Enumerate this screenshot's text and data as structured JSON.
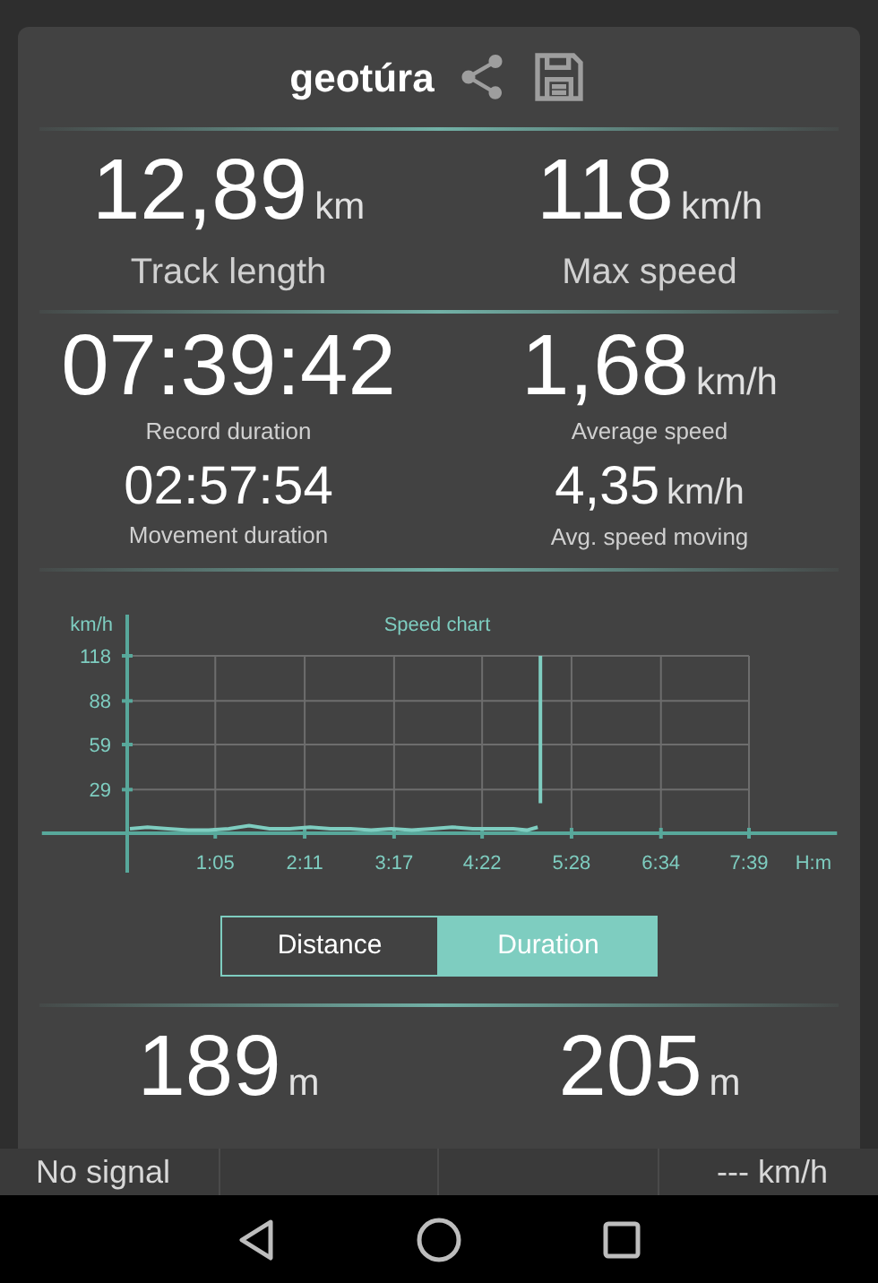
{
  "header": {
    "title": "geotúra"
  },
  "stat_sections": [
    {
      "items": [
        {
          "kind": "primary",
          "value": "12,89",
          "unit": "km",
          "label": "Track length"
        },
        {
          "kind": "primary",
          "value": "118",
          "unit": "km/h",
          "label": "Max speed"
        }
      ]
    },
    {
      "items": [
        {
          "kind": "secondary",
          "value": "07:39:42",
          "label": "Record duration"
        },
        {
          "kind": "secondary",
          "value": "1,68",
          "unit": "km/h",
          "label": "Average speed"
        },
        {
          "kind": "tertiary",
          "value": "02:57:54",
          "label": "Movement duration"
        },
        {
          "kind": "tertiary",
          "value": "4,35",
          "unit": "km/h",
          "label": "Avg. speed moving"
        }
      ]
    }
  ],
  "chart": {
    "chart_data": {
      "type": "line",
      "title": "Speed chart",
      "ylabel": "km/h",
      "xlabel": "H:m",
      "x": [
        2,
        15,
        30,
        45,
        60,
        75,
        90,
        105,
        120,
        135,
        150,
        165,
        180,
        195,
        210,
        225,
        240,
        255,
        270,
        285,
        295,
        303,
        null,
        305,
        305
      ],
      "series": [
        {
          "color": "#7ecdc0",
          "values": [
            3,
            4,
            3,
            2,
            2,
            3,
            5,
            3,
            3,
            4,
            3,
            3,
            2,
            3,
            2,
            3,
            4,
            3,
            3,
            3,
            2,
            4,
            null,
            118,
            20
          ]
        }
      ],
      "grid": true,
      "xlim": [
        -63,
        524
      ],
      "ylim": [
        0,
        118
      ],
      "xticks": [
        {
          "value": 65,
          "label": "1:05"
        },
        {
          "value": 131,
          "label": "2:11"
        },
        {
          "value": 197,
          "label": "3:17"
        },
        {
          "value": 262,
          "label": "4:22"
        },
        {
          "value": 328,
          "label": "5:28"
        },
        {
          "value": 394,
          "label": "6:34"
        },
        {
          "value": 459,
          "label": "7:39"
        }
      ],
      "yticks": [
        29,
        59,
        88,
        118
      ]
    }
  },
  "toggle": [
    {
      "label": "Distance",
      "selected": false
    },
    {
      "label": "Duration",
      "selected": true
    }
  ],
  "bottom_stats": [
    {
      "value": "189",
      "unit": "m"
    },
    {
      "value": "205",
      "unit": "m"
    }
  ],
  "status_bar": {
    "signal": "No signal",
    "speed": "--- km/h"
  }
}
